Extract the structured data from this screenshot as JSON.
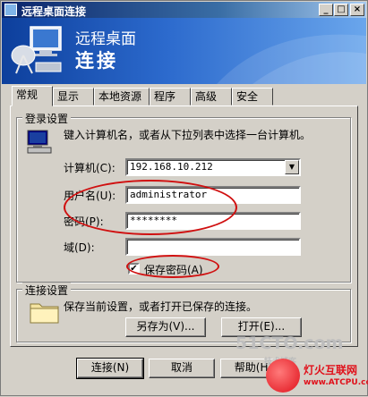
{
  "window": {
    "title": "远程桌面连接",
    "min_label": "_",
    "max_label": "□",
    "close_label": "×"
  },
  "banner": {
    "line1": "远程桌面",
    "line2": "连接"
  },
  "tabs": [
    {
      "label": "常规",
      "active": true
    },
    {
      "label": "显示"
    },
    {
      "label": "本地资源"
    },
    {
      "label": "程序"
    },
    {
      "label": "高级"
    },
    {
      "label": "安全"
    }
  ],
  "login_group": {
    "title": "登录设置",
    "description": "键入计算机名，或者从下拉列表中选择一台计算机。",
    "computer_label": "计算机(C):",
    "computer_value": "192.168.10.212",
    "username_label": "用户名(U):",
    "username_value": "administrator",
    "password_label": "密码(P):",
    "password_value": "********",
    "domain_label": "域(D):",
    "domain_value": "",
    "save_password_label": "保存密码(A)",
    "save_password_checked": "✔"
  },
  "connection_group": {
    "title": "连接设置",
    "description": "保存当前设置，或者打开已保存的连接。",
    "save_as_label": "另存为(V)...",
    "open_label": "打开(E)..."
  },
  "footer": {
    "connect_label": "连接(N)",
    "cancel_label": "取消",
    "help_label": "帮助(H)"
  },
  "watermarks": {
    "site": "51CTO.com",
    "sub": "技术博客",
    "logo_cn": "灯火互联网",
    "logo_en": "www.ATCPU.com"
  },
  "colors": {
    "annotation": "#d01010",
    "title_bar": "#0a246a",
    "face": "#d4d0c8"
  }
}
